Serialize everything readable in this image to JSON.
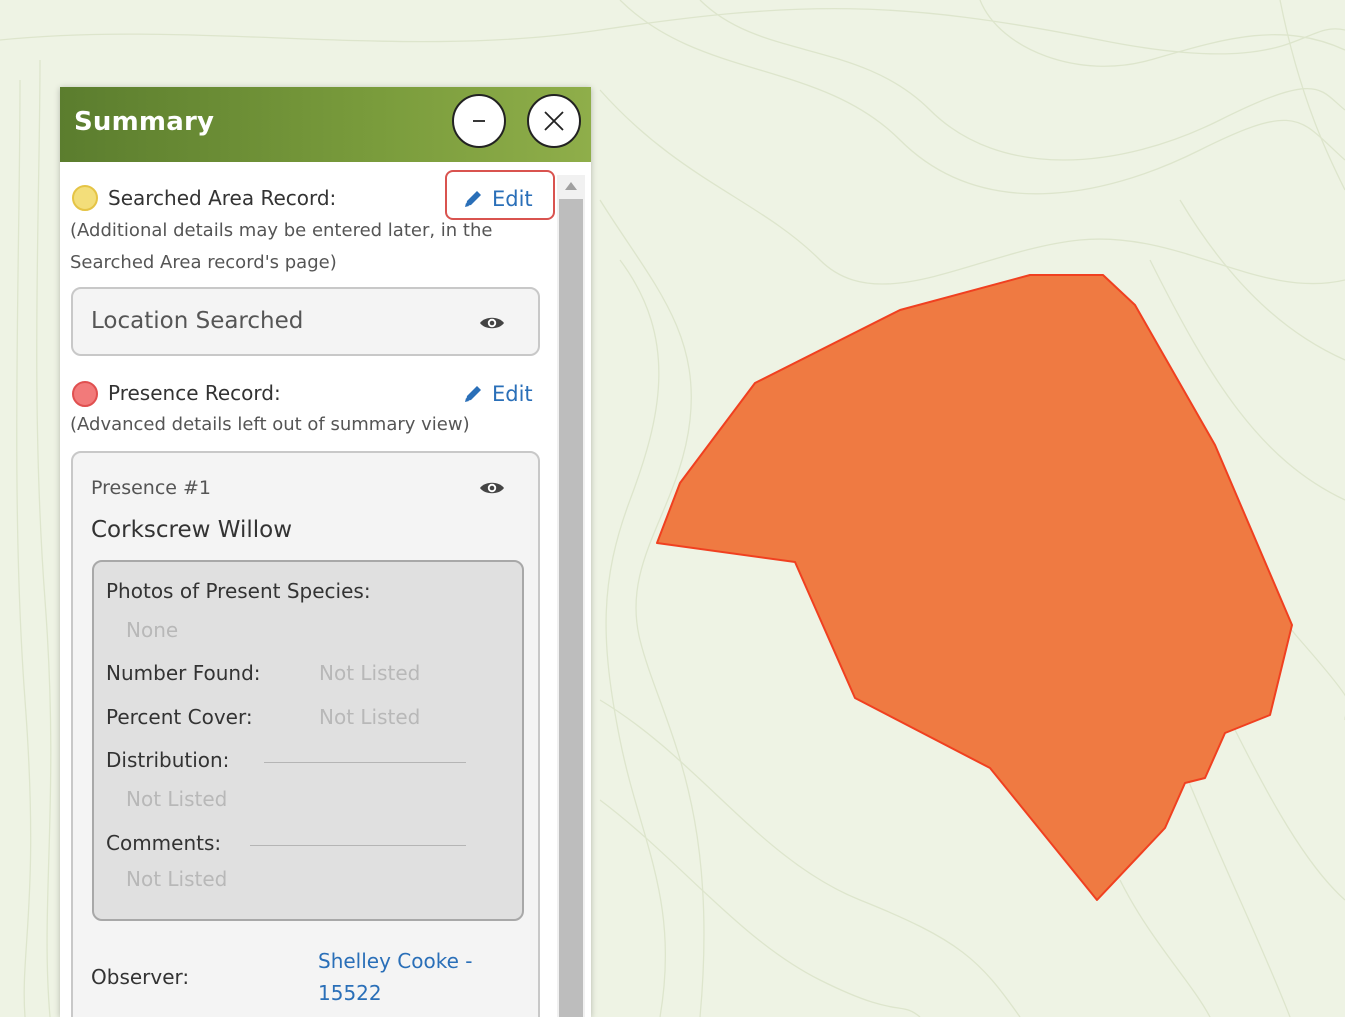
{
  "panel": {
    "title": "Summary",
    "minimize_symbol": "–",
    "close_icon": "close-icon"
  },
  "searched_area": {
    "label": "Searched Area Record:",
    "note_line1": "(Additional details may be entered later, in the",
    "note_line2": "Searched Area record's page)",
    "edit_label": "Edit",
    "location_label": "Location Searched",
    "status_color": "#f3de7a"
  },
  "presence": {
    "label": "Presence Record:",
    "note": "(Advanced details left out of summary view)",
    "edit_label": "Edit",
    "status_color": "#f27a7a",
    "item": {
      "heading": "Presence #1",
      "species": "Corkscrew Willow",
      "photos_label": "Photos of Present Species:",
      "photos_value": "None",
      "number_found_label": "Number Found:",
      "number_found_value": "Not Listed",
      "percent_cover_label": "Percent Cover:",
      "percent_cover_value": "Not Listed",
      "distribution_label": "Distribution:",
      "distribution_value": "Not Listed",
      "comments_label": "Comments:",
      "comments_value": "Not Listed",
      "observer_label": "Observer:",
      "observer_line1": "Shelley Cooke -",
      "observer_line2": "15522"
    }
  },
  "map": {
    "polygon_fill": "#ef7a42",
    "polygon_stroke": "#f04020",
    "background": "#eef3e4"
  }
}
